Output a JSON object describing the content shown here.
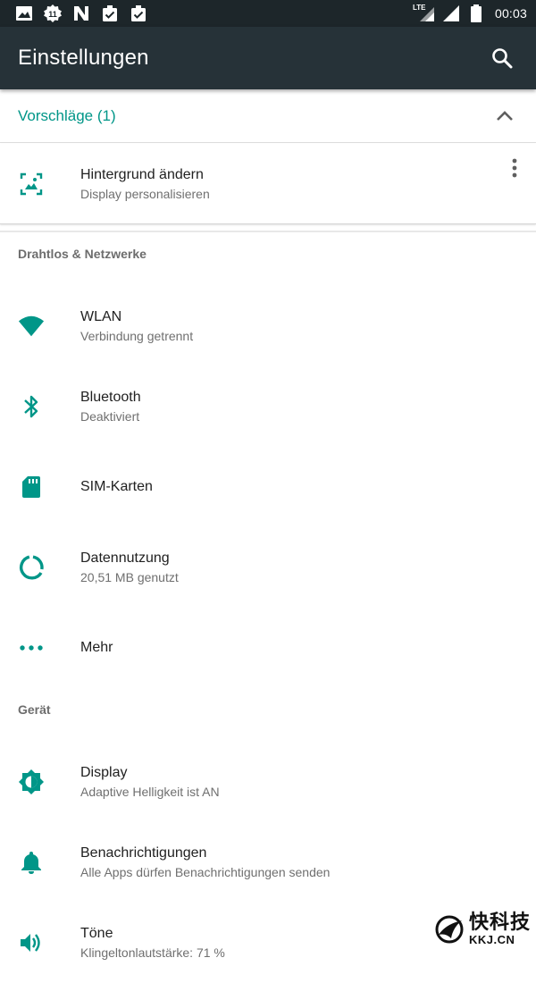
{
  "status_bar": {
    "time": "00:03",
    "network_label": "LTE"
  },
  "toolbar": {
    "title": "Einstellungen"
  },
  "suggestions": {
    "header": "Vorschläge (1)",
    "items": [
      {
        "title": "Hintergrund ändern",
        "subtitle": "Display personalisieren"
      }
    ]
  },
  "sections": [
    {
      "header": "Drahtlos & Netzwerke",
      "items": [
        {
          "title": "WLAN",
          "subtitle": "Verbindung getrennt",
          "icon": "wifi-icon"
        },
        {
          "title": "Bluetooth",
          "subtitle": "Deaktiviert",
          "icon": "bluetooth-icon"
        },
        {
          "title": "SIM-Karten",
          "subtitle": "",
          "icon": "sim-card-icon"
        },
        {
          "title": "Datennutzung",
          "subtitle": "20,51 MB genutzt",
          "icon": "data-usage-icon"
        },
        {
          "title": "Mehr",
          "subtitle": "",
          "icon": "more-icon"
        }
      ]
    },
    {
      "header": "Gerät",
      "items": [
        {
          "title": "Display",
          "subtitle": "Adaptive Helligkeit ist AN",
          "icon": "brightness-icon"
        },
        {
          "title": "Benachrichtigungen",
          "subtitle": "Alle Apps dürfen Benachrichtigungen senden",
          "icon": "bell-icon"
        },
        {
          "title": "Töne",
          "subtitle": "Klingeltonlautstärke: 71 %",
          "icon": "volume-icon"
        }
      ]
    }
  ],
  "watermark": {
    "main": "快科技",
    "sub": "KKJ.CN"
  },
  "colors": {
    "accent": "#009688",
    "toolbar": "#263238",
    "status_bar": "#1d262a"
  }
}
